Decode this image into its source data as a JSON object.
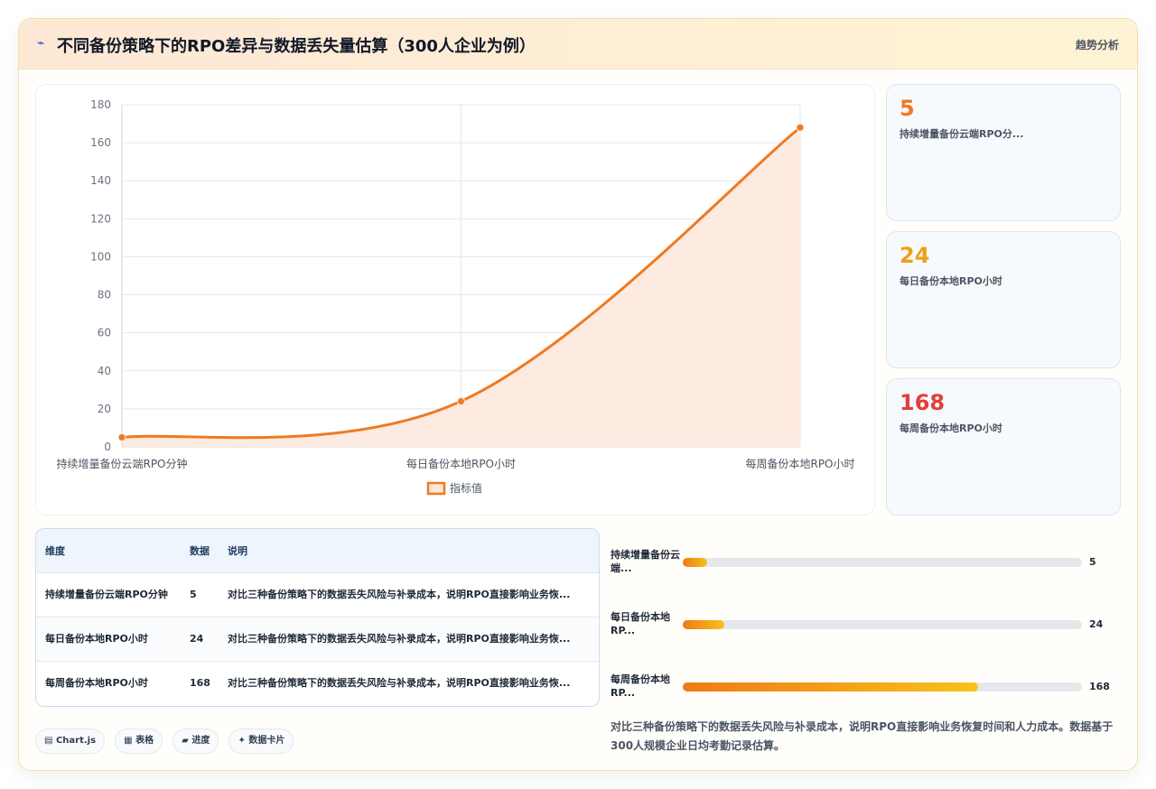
{
  "header": {
    "icon": "lightning-icon",
    "title": "不同备份策略下的RPO差异与数据丢失量估算（300人企业为例）",
    "tag": "趋势分析"
  },
  "chart_data": {
    "type": "line",
    "categories": [
      "持续增量备份云端RPO分钟",
      "每日备份本地RPO小时",
      "每周备份本地RPO小时"
    ],
    "series": [
      {
        "name": "指标值",
        "values": [
          5,
          24,
          168
        ],
        "color": "#ee7a22",
        "fill": "#fde6da"
      }
    ],
    "ylim": [
      0,
      180
    ],
    "yticks": [
      0,
      20,
      40,
      60,
      80,
      100,
      120,
      140,
      160,
      180
    ],
    "legend": "bottom",
    "grid": true
  },
  "stats": [
    {
      "value": "5",
      "label": "持续增量备份云端RPO分...",
      "color": "#ee7a22"
    },
    {
      "value": "24",
      "label": "每日备份本地RPO小时",
      "color": "#eea01a"
    },
    {
      "value": "168",
      "label": "每周备份本地RPO小时",
      "color": "#e0413a"
    }
  ],
  "table": {
    "headers": [
      "维度",
      "数据",
      "说明"
    ],
    "rows": [
      {
        "dim": "持续增量备份云端RPO分钟",
        "val": "5",
        "desc": "对比三种备份策略下的数据丢失风险与补录成本，说明RPO直接影响业务恢..."
      },
      {
        "dim": "每日备份本地RPO小时",
        "val": "24",
        "desc": "对比三种备份策略下的数据丢失风险与补录成本，说明RPO直接影响业务恢..."
      },
      {
        "dim": "每周备份本地RPO小时",
        "val": "168",
        "desc": "对比三种备份策略下的数据丢失风险与补录成本，说明RPO直接影响业务恢..."
      }
    ]
  },
  "progress": [
    {
      "label": "持续增量备份云端...",
      "value": "5",
      "fraction": 0.06
    },
    {
      "label": "每日备份本地RP...",
      "value": "24",
      "fraction": 0.105
    },
    {
      "label": "每周备份本地RP...",
      "value": "168",
      "fraction": 0.74
    }
  ],
  "note": "对比三种备份策略下的数据丢失风险与补录成本，说明RPO直接影响业务恢复时间和人力成本。数据基于300人规模企业日均考勤记录估算。",
  "chips": [
    {
      "icon": "▤",
      "label": "Chart.js"
    },
    {
      "icon": "▦",
      "label": "表格"
    },
    {
      "icon": "▰",
      "label": "进度"
    },
    {
      "icon": "✦",
      "label": "数据卡片"
    }
  ]
}
